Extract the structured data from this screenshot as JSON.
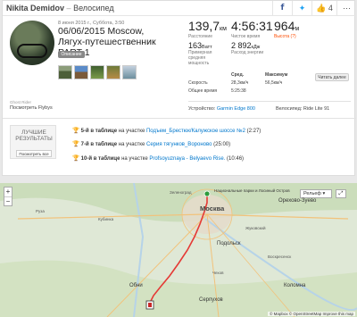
{
  "header": {
    "athlete": "Nikita Demidov",
    "separator": "–",
    "sport": "Велосипед",
    "icons": [
      "facebook-icon",
      "twitter-icon",
      "kudos-icon",
      "more-icon"
    ],
    "kudos_count": "4"
  },
  "activity": {
    "date": "8 июня 2015 г., Суббота, 3:50",
    "title": "06/06/2015 Moscow, Лягух-путешественник PART 1",
    "description_button": "Описание"
  },
  "stats": {
    "distance": "139,7",
    "distance_unit": "км",
    "distance_label": "Расстояние",
    "time": "4:56:31",
    "time_label": "Чистое время",
    "elevation": "964",
    "elevation_unit": "м",
    "elevation_label": "Высота (?)",
    "power": "163",
    "power_unit": "Ватт",
    "power_label_1": "Примерная",
    "power_label_2": "средняя",
    "power_label_3": "мощность",
    "energy": "2 892",
    "energy_unit": "кДж",
    "energy_label": "Расход энергии"
  },
  "table": {
    "col_avg": "Сред.",
    "col_max": "Максимум",
    "rows": [
      {
        "label": "Скорость",
        "avg": "28,3км/ч",
        "max": "56,5км/ч"
      },
      {
        "label": "Общее время",
        "avg": "5:25:38",
        "max": ""
      }
    ],
    "read_more": "Читать далее"
  },
  "device": {
    "label": "Устройство:",
    "name": "Garmin Edge 800",
    "bike_label": "Велосипед:",
    "bike_name": "Ride Lite 91"
  },
  "flyby": {
    "caption": "Ghost Rider",
    "link": "Посмотреть Flybys"
  },
  "best": {
    "title": "ЛУЧШИЕ РЕЗУЛЬТАТЫ",
    "button": "Посмотреть все",
    "achievements": [
      {
        "rank": "5-й в таблице",
        "on": "на участке",
        "segment": "Подъем_Брестюк/Калужское шоссе №2",
        "time": "(2:27)"
      },
      {
        "rank": "7-й в таблице",
        "on": "на участке",
        "segment": "Серия тягунков_Вороново",
        "time": "(25:00)"
      },
      {
        "rank": "10-й в таблице",
        "on": "на участке",
        "segment": "Profsoyuznaya - Belyaevo Rise.",
        "time": "(10:46)"
      }
    ]
  },
  "map": {
    "layer_button": "Рельеф ▾",
    "zoom_in": "+",
    "zoom_out": "−",
    "start_label": "Национальные парки и Лосиный Остров",
    "labels": {
      "moscow": "Москва",
      "orekhovo": "Орехово-Зуево",
      "podolsk": "Подольск",
      "kolomna": "Коломна",
      "obninsk": "Обни",
      "serpukhov": "Серпухов",
      "ruza": "Руза",
      "kubinka": "Кубинка",
      "chekhov": "Чехов",
      "zhukovsky": "Жуковский",
      "voskresensk": "Воскресенск",
      "zelenograd": "Зеленоград"
    },
    "attribution": "© Mapbox © OpenStreetMap Improve this map",
    "colors": {
      "route": "#e53935",
      "water": "#b6d3e8",
      "forest": "#c6d9b4"
    }
  }
}
